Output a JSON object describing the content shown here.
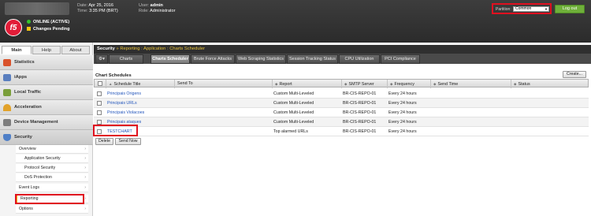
{
  "header": {
    "date_label": "Date:",
    "date_value": "Apr 25, 2016",
    "time_label": "Time:",
    "time_value": "3:35 PM (BRT)",
    "user_label": "User:",
    "user_value": "admin",
    "role_label": "Role:",
    "role_value": "Administrator",
    "logo_text": "f5",
    "status_online": "ONLINE (ACTIVE)",
    "status_pending": "Changes Pending",
    "partition_label": "Partition:",
    "partition_value": "Common",
    "logout_label": "Log out"
  },
  "nav": {
    "tabs": [
      "Main",
      "Help",
      "About"
    ],
    "groups": [
      "Statistics",
      "iApps",
      "Local Traffic",
      "Acceleration",
      "Device Management",
      "Security"
    ],
    "security_items": [
      {
        "label": "Overview",
        "indent": false
      },
      {
        "label": "Application Security",
        "indent": true
      },
      {
        "label": "Protocol Security",
        "indent": true
      },
      {
        "label": "DoS Protection",
        "indent": true
      },
      {
        "label": "Event Logs",
        "indent": false
      },
      {
        "label": "Reporting",
        "indent": false
      },
      {
        "label": "Options",
        "indent": false
      }
    ]
  },
  "breadcrumb": {
    "root": "Security",
    "sep": "»",
    "path": "Reporting : Application : Charts Scheduler"
  },
  "tabs": [
    "Charts",
    "Charts Scheduler",
    "Brute Force Attacks",
    "Web Scraping Statistics",
    "Session Tracking Status",
    "CPU Utilization",
    "PCI Compliance"
  ],
  "section": {
    "title": "Chart Schedules",
    "create_label": "Create..."
  },
  "table": {
    "columns": [
      "Schedule Title",
      "Send To",
      "Report",
      "SMTP Server",
      "Frequency",
      "Send Time",
      "Status"
    ],
    "rows": [
      {
        "title": "Principais Origens",
        "send_to": "",
        "report": "Custom Multi-Leveled",
        "smtp": "BR-CIS-REPO-01",
        "frequency": "Every 24 hours",
        "send_time": "",
        "status": ""
      },
      {
        "title": "Principais URLs",
        "send_to": "",
        "report": "Custom Multi-Leveled",
        "smtp": "BR-CIS-REPO-01",
        "frequency": "Every 24 hours",
        "send_time": "",
        "status": ""
      },
      {
        "title": "Principais Violacoes",
        "send_to": "",
        "report": "Custom Multi-Leveled",
        "smtp": "BR-CIS-REPO-01",
        "frequency": "Every 24 hours",
        "send_time": "",
        "status": ""
      },
      {
        "title": "Principais ataques",
        "send_to": "",
        "report": "Custom Multi-Leveled",
        "smtp": "BR-CIS-REPO-01",
        "frequency": "Every 24 hours",
        "send_time": "",
        "status": ""
      },
      {
        "title": "TESTCHART",
        "send_to": "",
        "report": "Top alarmed URLs",
        "smtp": "BR-CIS-REPO-01",
        "frequency": "Every 24 hours",
        "send_time": "",
        "status": ""
      }
    ],
    "delete_label": "Delete",
    "send_now_label": "Send Now"
  }
}
